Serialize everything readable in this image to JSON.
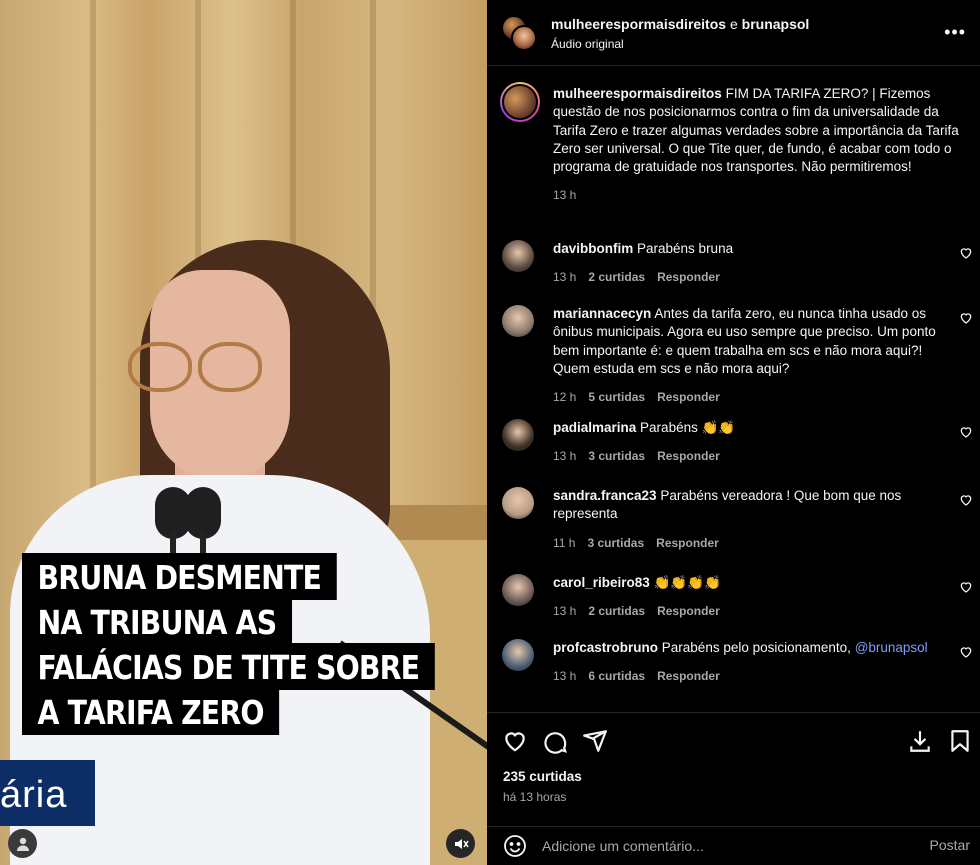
{
  "video": {
    "caption_lines": [
      "BRUNA DESMENTE",
      "NA TRIBUNA AS",
      "FALÁCIAS DE TITE SOBRE",
      "A TARIFA ZERO"
    ],
    "logo_text": "ária",
    "profile_icon": "user-icon",
    "mute_icon": "volume-muted-icon"
  },
  "header": {
    "author": "mulheerespormaisdireitos",
    "joiner": "e",
    "collaborator": "brunapsol",
    "audio": "Áudio original",
    "more_icon": "more-horizontal-icon"
  },
  "caption": {
    "username": "mulheerespormaisdireitos",
    "text": "FIM DA TARIFA ZERO? | Fizemos questão de nos posicionarmos contra o fim da universalidade da Tarifa Zero e trazer algumas verdades sobre a importância da Tarifa Zero ser universal. O que Tite quer, de fundo, é acabar com todo o programa de gratuidade nos transportes. Não permitiremos!",
    "time": "13 h"
  },
  "comments": [
    {
      "username": "davibbonfim",
      "text": "Parabéns bruna",
      "time": "13 h",
      "likes": "2 curtidas",
      "reply": "Responder",
      "avatar_color": "#5a4a40"
    },
    {
      "username": "mariannacecyn",
      "text": "Antes da tarifa zero, eu nunca tinha usado os ônibus municipais. Agora eu uso sempre que preciso. Um ponto bem importante é: e quem trabalha em scs e não mora aqui?! Quem estuda em scs e não mora aqui?",
      "time": "12 h",
      "likes": "5 curtidas",
      "reply": "Responder",
      "avatar_color": "#8a7a6e"
    },
    {
      "username": "padialmarina",
      "text": "Parabéns 👏👏",
      "time": "13 h",
      "likes": "3 curtidas",
      "reply": "Responder",
      "avatar_color": "#3c3124"
    },
    {
      "username": "sandra.franca23",
      "text": "Parabéns vereadora ! Que bom que nos representa",
      "time": "11 h",
      "likes": "3 curtidas",
      "reply": "Responder",
      "avatar_color": "#b79b84"
    },
    {
      "username": "carol_ribeiro83",
      "text": "👏👏👏👏",
      "time": "13 h",
      "likes": "2 curtidas",
      "reply": "Responder",
      "avatar_color": "#6b5a55"
    },
    {
      "username": "profcastrobruno",
      "text": "Parabéns pelo posicionamento,",
      "mention": "@brunapsol",
      "time": "13 h",
      "likes": "6 curtidas",
      "reply": "Responder",
      "avatar_color": "#4d5f75"
    }
  ],
  "actions": {
    "like_icon": "heart-icon",
    "comment_icon": "comment-icon",
    "share_icon": "send-icon",
    "save_icon": "bookmark-icon",
    "download_icon": "download-icon"
  },
  "stats": {
    "likes": "235 curtidas",
    "ago": "há 13 horas"
  },
  "composer": {
    "emoji_icon": "emoji-icon",
    "placeholder": "Adicione um comentário...",
    "post_label": "Postar"
  }
}
